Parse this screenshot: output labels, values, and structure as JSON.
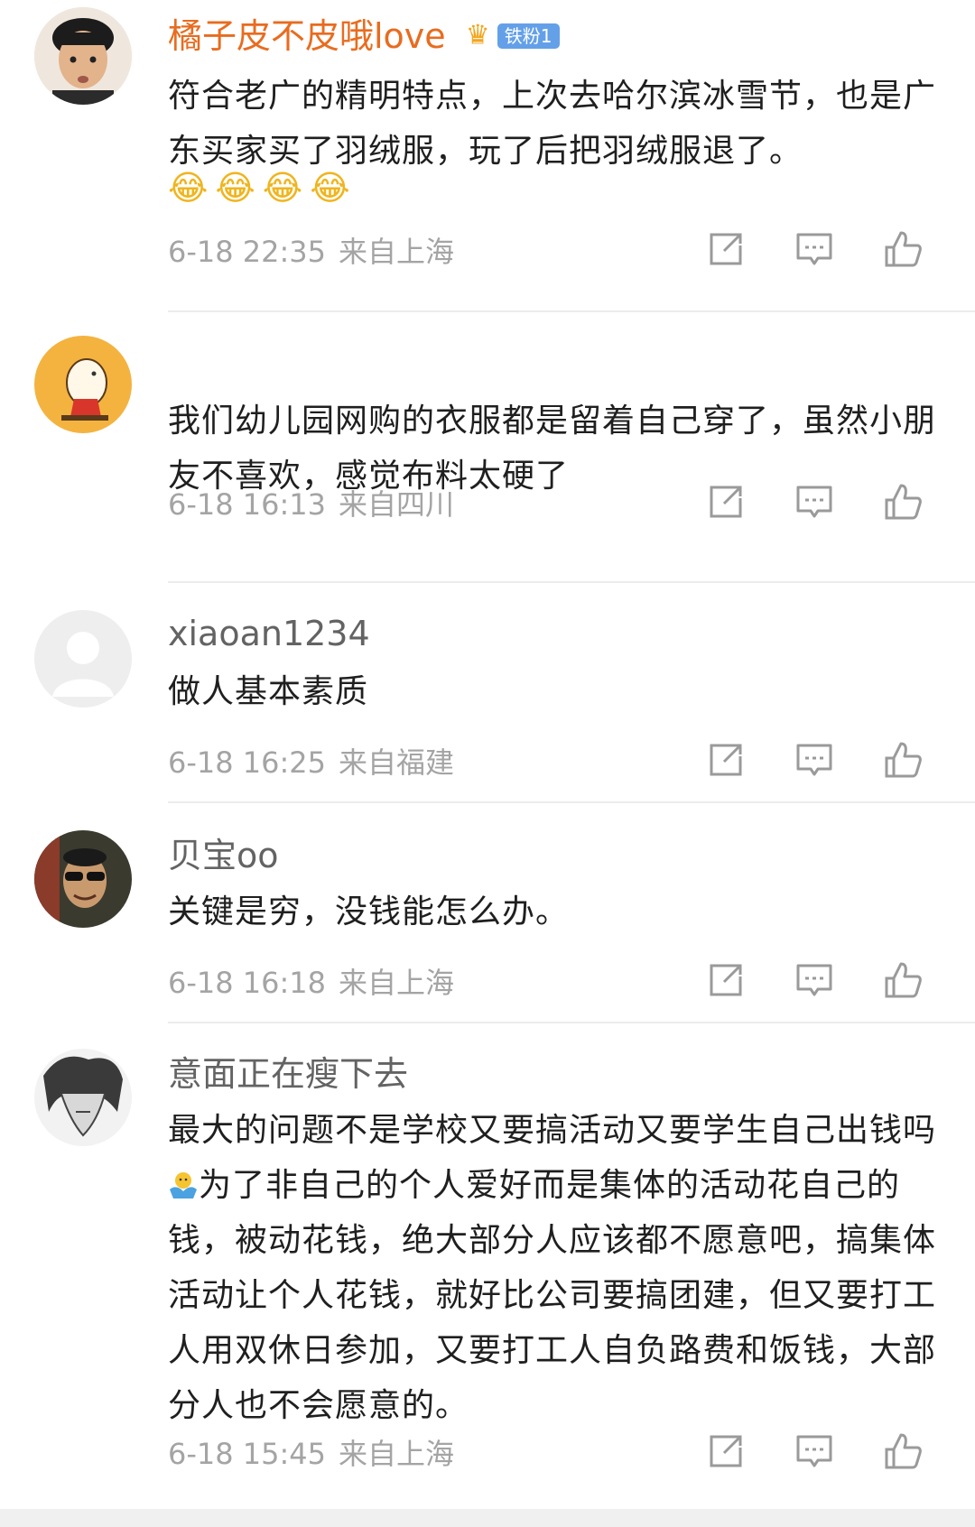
{
  "comments": [
    {
      "username": "橘子皮不皮哦love",
      "badge_label": "铁粉1",
      "text": "符合老广的精明特点，上次去哈尔滨冰雪节，也是广东买家买了羽绒服，玩了后把羽绒服退了。",
      "emojis": "😂😂😂😂",
      "time": "6-18 22:35",
      "location": "来自上海"
    },
    {
      "username": "",
      "text": "我们幼儿园网购的衣服都是留着自己穿了，虽然小朋友不喜欢，感觉布料太硬了",
      "time": "6-18 16:13",
      "location": "来自四川"
    },
    {
      "username": "xiaoan1234",
      "text": "做人基本素质",
      "time": "6-18 16:25",
      "location": "来自福建"
    },
    {
      "username": "贝宝oo",
      "text": "关键是穷，没钱能怎么办。",
      "time": "6-18 16:18",
      "location": "来自上海"
    },
    {
      "username": "意面正在瘦下去",
      "text_part1": "最大的问题不是学校又要搞活动又要学生自己出钱吗",
      "text_part2": "为了非自己的个人爱好而是集体的活动花自己的钱，被动花钱，绝大部分人应该都不愿意吧，搞集体活动让个人花钱，就好比公司要搞团建，但又要打工人用双休日参加，又要打工人自负路费和饭钱，大部分人也不会愿意的。",
      "time": "6-18 15:45",
      "location": "来自上海"
    }
  ],
  "icons": {
    "repost": "repost-icon",
    "comment": "comment-icon",
    "like": "like-icon"
  },
  "colors": {
    "vip_name": "#e86c1f",
    "username": "#636363",
    "meta": "#a4a4a4",
    "badge": "#64a0e8"
  }
}
